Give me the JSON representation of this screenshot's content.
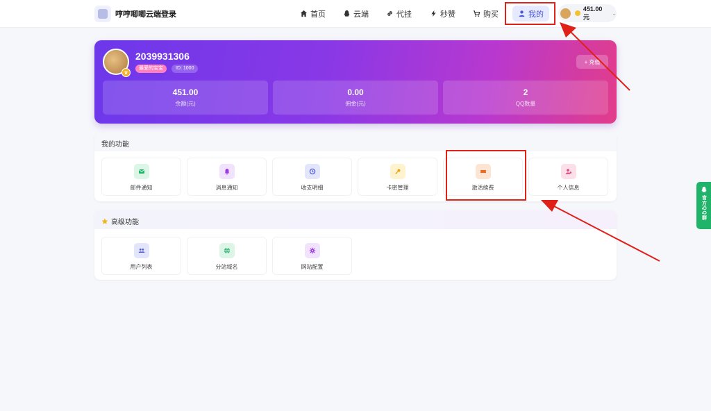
{
  "brand": {
    "title": "哼哼唧唧云端登录"
  },
  "nav": {
    "items": [
      {
        "label": "首页",
        "icon": "home-icon"
      },
      {
        "label": "云端",
        "icon": "qq-icon"
      },
      {
        "label": "代挂",
        "icon": "link-icon"
      },
      {
        "label": "秒赞",
        "icon": "bolt-icon"
      },
      {
        "label": "购买",
        "icon": "cart-icon"
      },
      {
        "label": "我的",
        "icon": "user-icon",
        "active": true
      }
    ]
  },
  "wallet": {
    "balance": "451.00元"
  },
  "profile": {
    "username": "2039931306",
    "tag": "最爱的宝宝",
    "id_label": "ID: 1000",
    "recharge_label": "充值",
    "stats": [
      {
        "value": "451.00",
        "label": "余额(元)"
      },
      {
        "value": "0.00",
        "label": "佣金(元)"
      },
      {
        "value": "2",
        "label": "QQ数量"
      }
    ]
  },
  "my_functions": {
    "title": "我的功能",
    "items": [
      {
        "label": "邮件通知",
        "icon": "mail-icon",
        "color": "#22b36b",
        "bg": "#dcf5e7"
      },
      {
        "label": "消息通知",
        "icon": "bell-icon",
        "color": "#9b3de0",
        "bg": "#f1e3fb"
      },
      {
        "label": "收支明细",
        "icon": "history-icon",
        "color": "#4f5bd5",
        "bg": "#e3e6fa"
      },
      {
        "label": "卡密管理",
        "icon": "key-icon",
        "color": "#e8a318",
        "bg": "#fdf3cf"
      },
      {
        "label": "激活续费",
        "icon": "ticket-icon",
        "color": "#ef6a1e",
        "bg": "#fde5d4"
      },
      {
        "label": "个人信息",
        "icon": "user-cog-icon",
        "color": "#e0457f",
        "bg": "#fbe0ea"
      }
    ]
  },
  "advanced": {
    "title": "高级功能",
    "items": [
      {
        "label": "用户列表",
        "icon": "users-icon",
        "color": "#4f5bd5",
        "bg": "#e3e6fa"
      },
      {
        "label": "分站域名",
        "icon": "globe-icon",
        "color": "#22b36b",
        "bg": "#dcf5e7"
      },
      {
        "label": "网站配置",
        "icon": "cog-icon",
        "color": "#9b3de0",
        "bg": "#f1e3fb"
      }
    ]
  },
  "qq_group": {
    "label": "官方QQ群"
  },
  "colors": {
    "accent": "#4a56d6",
    "annotation": "#e0211a",
    "qq_green": "#20b36a"
  }
}
